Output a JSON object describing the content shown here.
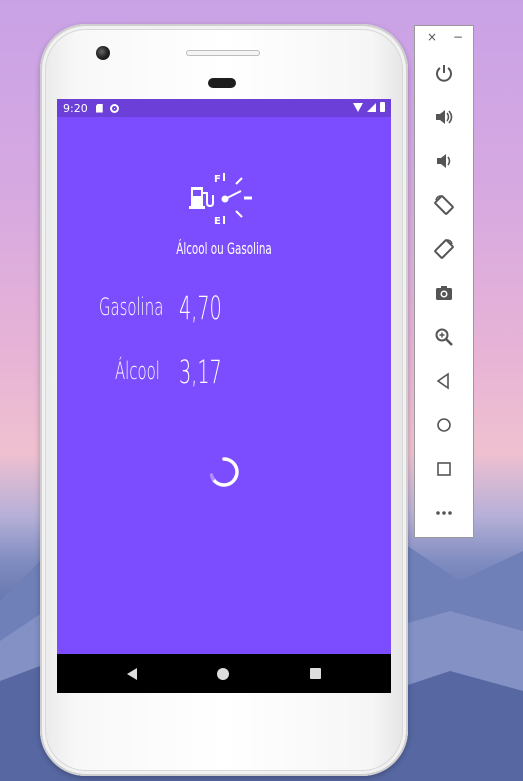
{
  "status_bar": {
    "time": "9:20"
  },
  "app": {
    "title": "Álcool ou Gasolina",
    "gasolina_label": "Gasolina",
    "gasolina_value": "4,70",
    "alcool_label": "Álcool",
    "alcool_value": "3,17",
    "accent_color": "#7c4dff",
    "statusbar_color": "#6b3fd8"
  },
  "emulator_toolbar": {
    "close": "×",
    "minimize": "−",
    "buttons": [
      "power-icon",
      "volume-up-icon",
      "volume-down-icon",
      "rotate-left-icon",
      "rotate-right-icon",
      "camera-icon",
      "zoom-icon",
      "back-icon",
      "home-icon",
      "overview-icon",
      "more-icon"
    ]
  }
}
